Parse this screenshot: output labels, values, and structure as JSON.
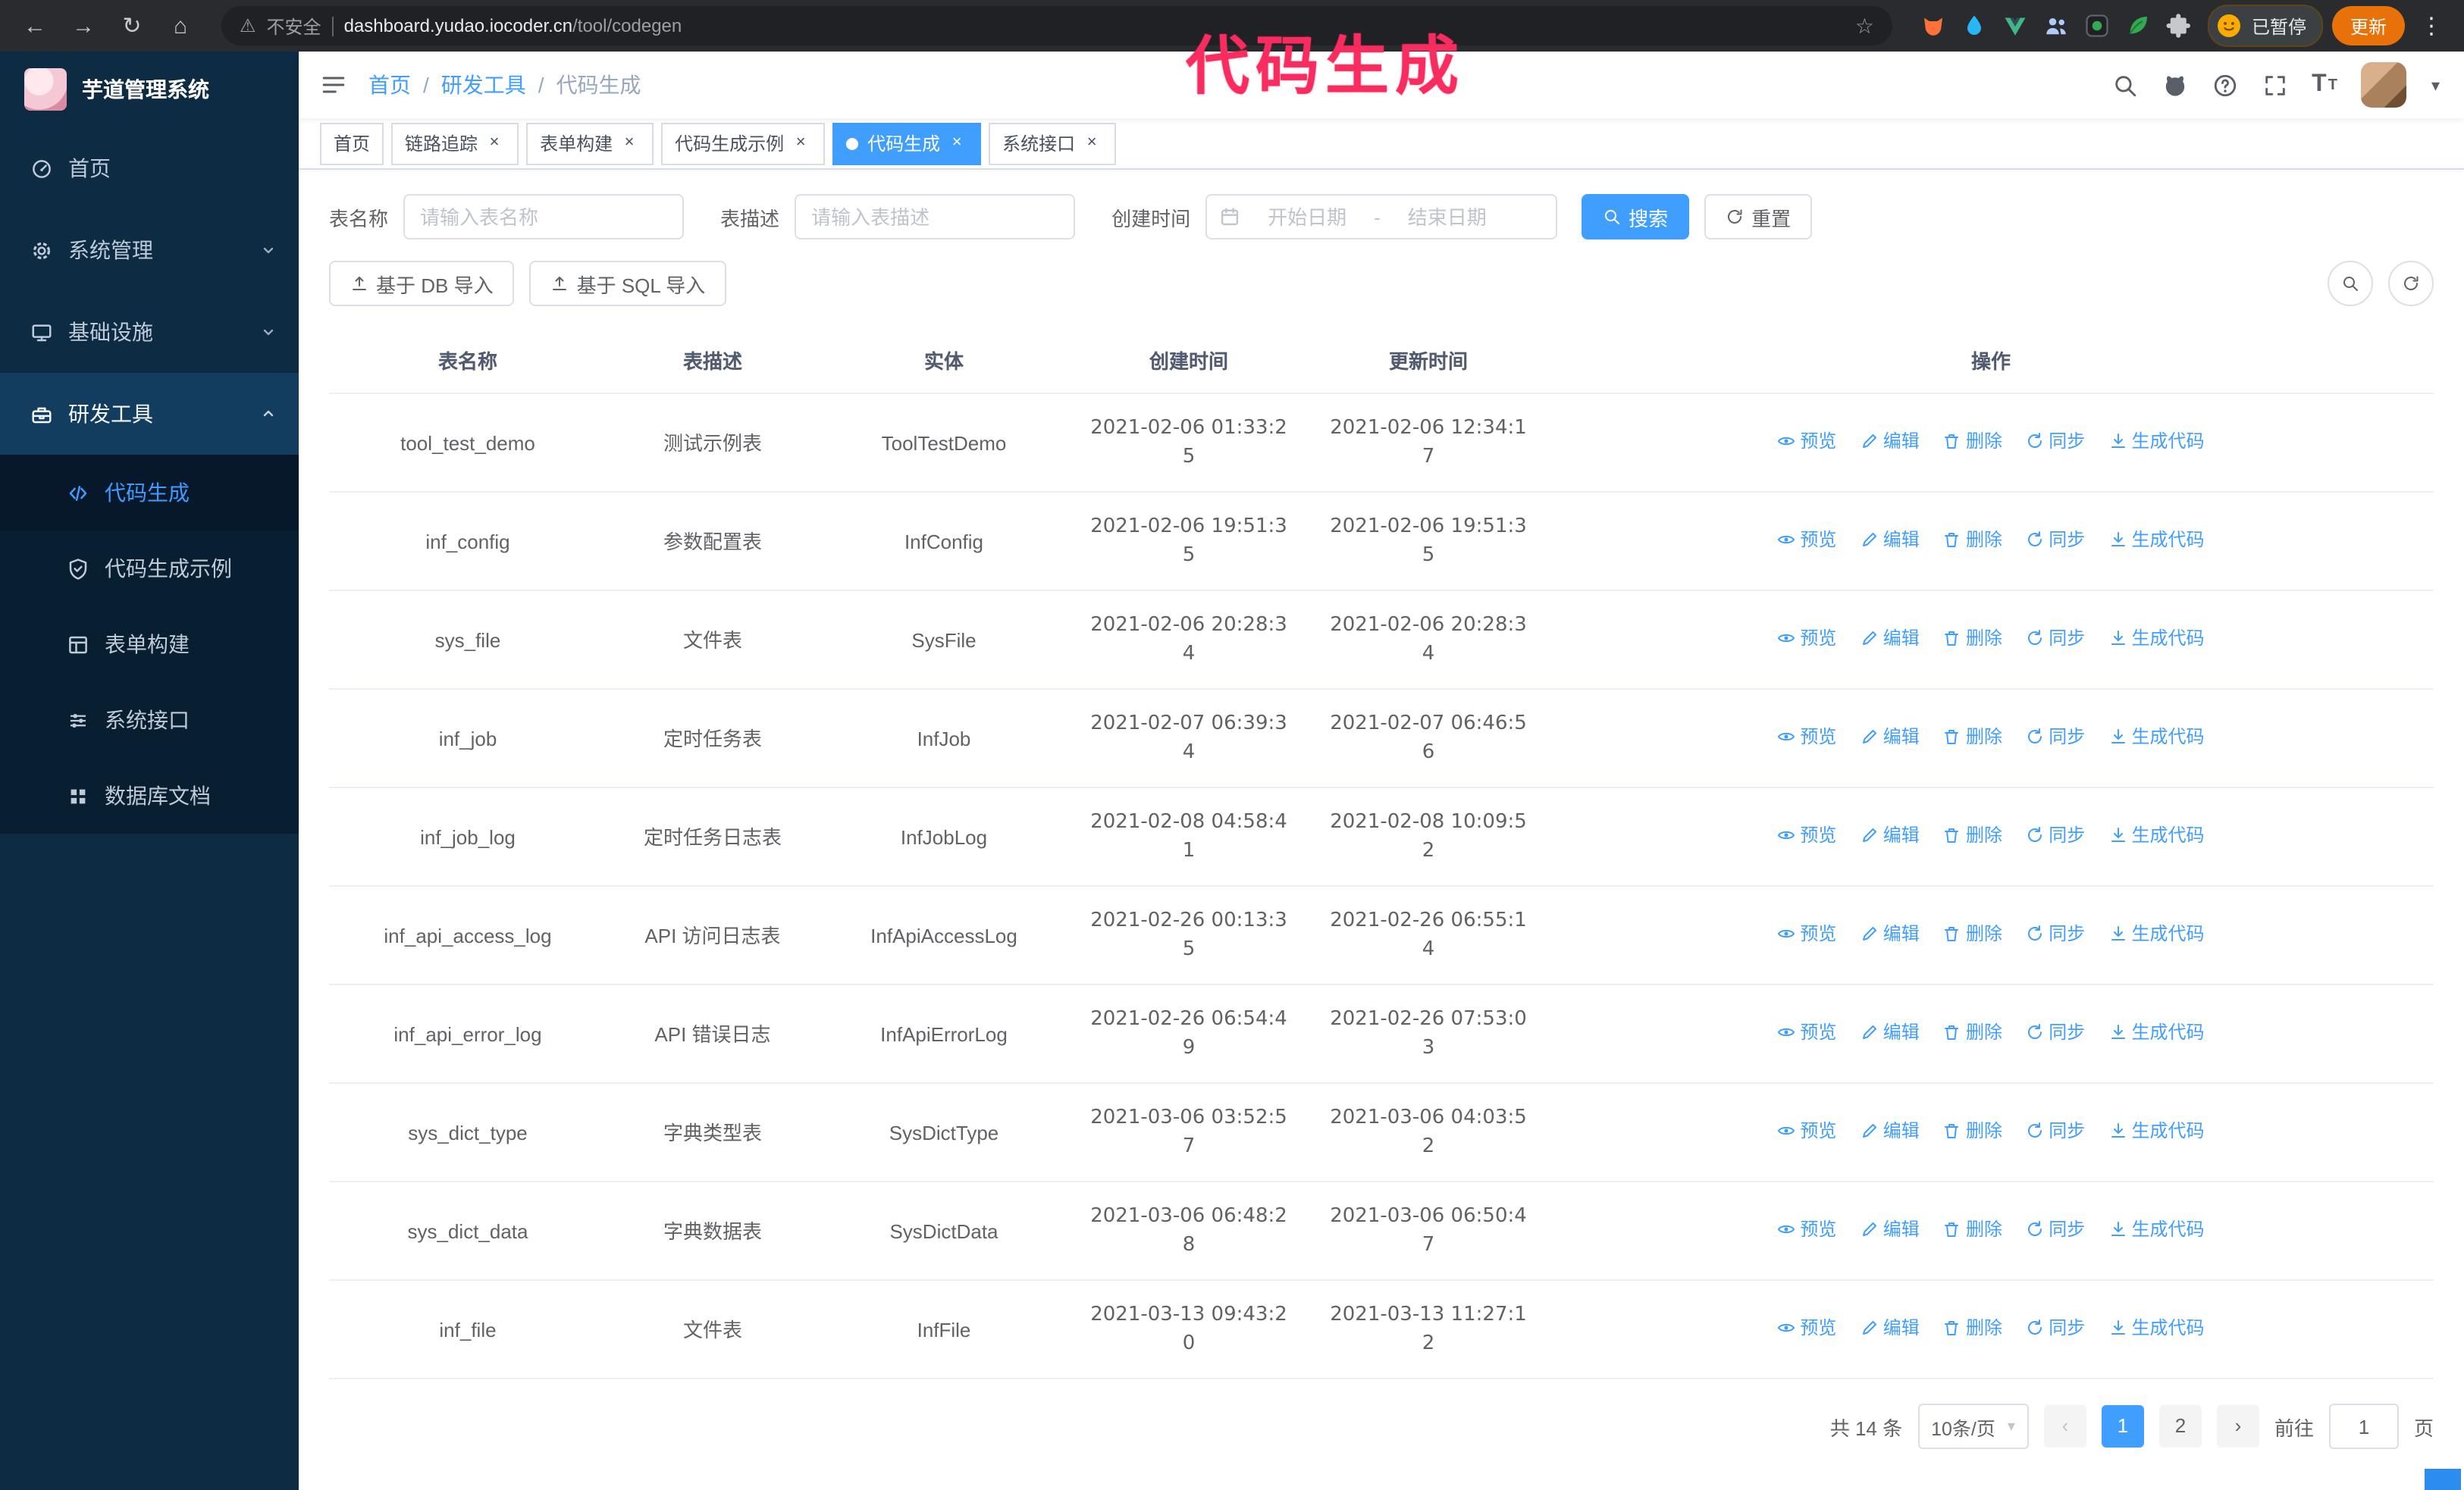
{
  "browser": {
    "security_label": "不安全",
    "url_host": "dashboard.yudao.iocoder.cn",
    "url_path": "/tool/codegen",
    "paused_badge": "已暂停",
    "update_button": "更新"
  },
  "icons": {
    "back": "←",
    "forward": "→",
    "reload": "↻",
    "home": "⌂",
    "warning": "⚠",
    "star": "☆",
    "menu_dots": "⋮",
    "caret_down": "▾",
    "close": "×",
    "prev": "‹",
    "next": "›",
    "font_size": "T"
  },
  "annotation": {
    "text": "代码生成",
    "color": "#f92c5f"
  },
  "sidebar": {
    "logo_title": "芋道管理系统",
    "items": [
      {
        "label": "首页"
      },
      {
        "label": "系统管理"
      },
      {
        "label": "基础设施"
      },
      {
        "label": "研发工具"
      }
    ],
    "submenu": [
      {
        "label": "代码生成"
      },
      {
        "label": "代码生成示例"
      },
      {
        "label": "表单构建"
      },
      {
        "label": "系统接口"
      },
      {
        "label": "数据库文档"
      }
    ]
  },
  "breadcrumb": {
    "items": [
      "首页",
      "研发工具",
      "代码生成"
    ],
    "separator": "/"
  },
  "tabs": [
    {
      "label": "首页"
    },
    {
      "label": "链路追踪"
    },
    {
      "label": "表单构建"
    },
    {
      "label": "代码生成示例"
    },
    {
      "label": "代码生成"
    },
    {
      "label": "系统接口"
    }
  ],
  "filters": {
    "table_name_label": "表名称",
    "table_name_placeholder": "请输入表名称",
    "table_desc_label": "表描述",
    "table_desc_placeholder": "请输入表描述",
    "create_time_label": "创建时间",
    "date_start_placeholder": "开始日期",
    "date_separator": "-",
    "date_end_placeholder": "结束日期",
    "search_button": "搜索",
    "reset_button": "重置"
  },
  "toolbar": {
    "import_db": "基于 DB 导入",
    "import_sql": "基于 SQL 导入"
  },
  "table": {
    "columns": [
      "表名称",
      "表描述",
      "实体",
      "创建时间",
      "更新时间",
      "操作"
    ],
    "actions": [
      "预览",
      "编辑",
      "删除",
      "同步",
      "生成代码"
    ],
    "rows": [
      {
        "name": "tool_test_demo",
        "desc": "测试示例表",
        "entity": "ToolTestDemo",
        "created": "2021-02-06 01:33:25",
        "updated": "2021-02-06 12:34:17"
      },
      {
        "name": "inf_config",
        "desc": "参数配置表",
        "entity": "InfConfig",
        "created": "2021-02-06 19:51:35",
        "updated": "2021-02-06 19:51:35"
      },
      {
        "name": "sys_file",
        "desc": "文件表",
        "entity": "SysFile",
        "created": "2021-02-06 20:28:34",
        "updated": "2021-02-06 20:28:34"
      },
      {
        "name": "inf_job",
        "desc": "定时任务表",
        "entity": "InfJob",
        "created": "2021-02-07 06:39:34",
        "updated": "2021-02-07 06:46:56"
      },
      {
        "name": "inf_job_log",
        "desc": "定时任务日志表",
        "entity": "InfJobLog",
        "created": "2021-02-08 04:58:41",
        "updated": "2021-02-08 10:09:52"
      },
      {
        "name": "inf_api_access_log",
        "desc": "API 访问日志表",
        "entity": "InfApiAccessLog",
        "created": "2021-02-26 00:13:35",
        "updated": "2021-02-26 06:55:14"
      },
      {
        "name": "inf_api_error_log",
        "desc": "API 错误日志",
        "entity": "InfApiErrorLog",
        "created": "2021-02-26 06:54:49",
        "updated": "2021-02-26 07:53:03"
      },
      {
        "name": "sys_dict_type",
        "desc": "字典类型表",
        "entity": "SysDictType",
        "created": "2021-03-06 03:52:57",
        "updated": "2021-03-06 04:03:52"
      },
      {
        "name": "sys_dict_data",
        "desc": "字典数据表",
        "entity": "SysDictData",
        "created": "2021-03-06 06:48:28",
        "updated": "2021-03-06 06:50:47"
      },
      {
        "name": "inf_file",
        "desc": "文件表",
        "entity": "InfFile",
        "created": "2021-03-13 09:43:20",
        "updated": "2021-03-13 11:27:12"
      }
    ]
  },
  "pagination": {
    "total": "共 14 条",
    "page_size": "10条/页",
    "pages": [
      "1",
      "2"
    ],
    "goto_label": "前往",
    "goto_value": "1",
    "goto_suffix": "页"
  }
}
